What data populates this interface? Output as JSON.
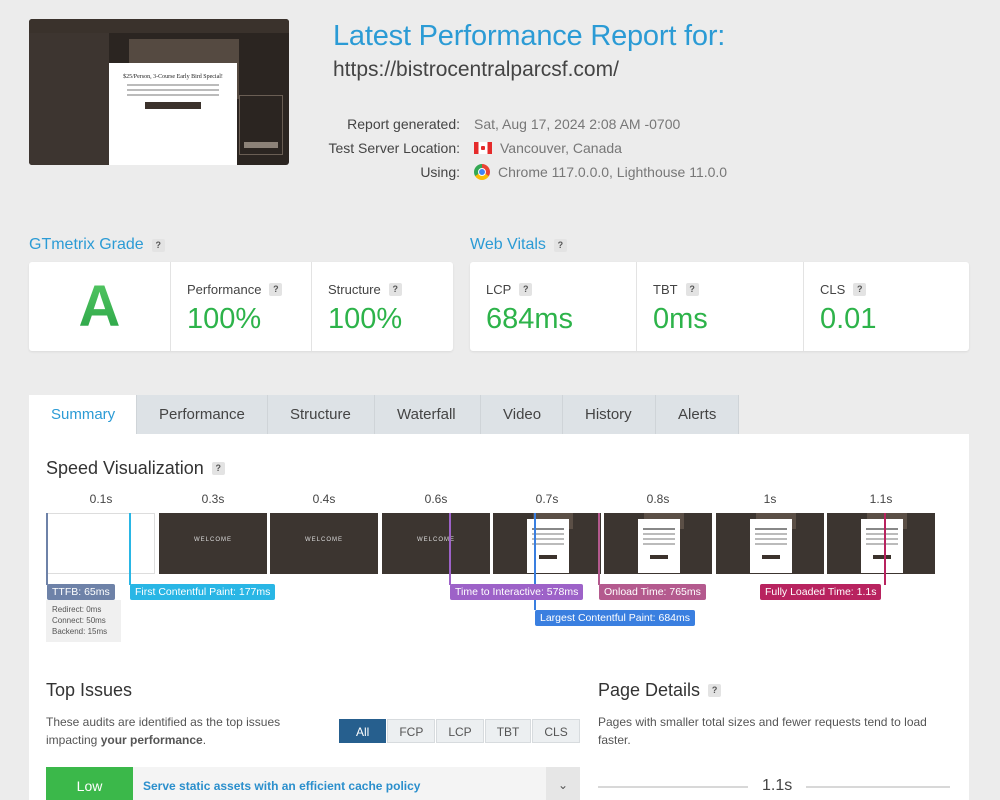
{
  "header": {
    "title": "Latest Performance Report for:",
    "url": "https://bistrocentralparcsf.com/",
    "report_generated_label": "Report generated:",
    "report_generated_value": "Sat, Aug 17, 2024 2:08 AM -0700",
    "server_label": "Test Server Location:",
    "server_value": "Vancouver, Canada",
    "using_label": "Using:",
    "using_value": "Chrome 117.0.0.0, Lighthouse 11.0.0"
  },
  "thumbnail": {
    "modal_text": "$25/Person, 3-Course Early Bird Special!"
  },
  "grade": {
    "title": "GTmetrix Grade",
    "letter": "A",
    "performance_label": "Performance",
    "performance_value": "100%",
    "structure_label": "Structure",
    "structure_value": "100%"
  },
  "vitals": {
    "title": "Web Vitals",
    "lcp_label": "LCP",
    "lcp_value": "684ms",
    "tbt_label": "TBT",
    "tbt_value": "0ms",
    "cls_label": "CLS",
    "cls_value": "0.01"
  },
  "tabs": [
    "Summary",
    "Performance",
    "Structure",
    "Waterfall",
    "Video",
    "History",
    "Alerts"
  ],
  "speed": {
    "title": "Speed Visualization",
    "frame_times": [
      "0.1s",
      "0.3s",
      "0.4s",
      "0.6s",
      "0.7s",
      "0.8s",
      "1s",
      "1.1s"
    ],
    "frame_text": "WELCOME",
    "ttfb": "TTFB: 65ms",
    "ttfb_redirect": "Redirect: 0ms",
    "ttfb_connect": "Connect: 50ms",
    "ttfb_backend": "Backend: 15ms",
    "fcp": "First Contentful Paint: 177ms",
    "tti": "Time to Interactive: 578ms",
    "onload": "Onload Time: 765ms",
    "fully_loaded": "Fully Loaded Time: 1.1s",
    "lcp": "Largest Contentful Paint: 684ms"
  },
  "top_issues": {
    "title": "Top Issues",
    "desc_1": "These audits are identified as the top issues",
    "desc_2": "impacting ",
    "desc_bold": "your performance",
    "desc_end": ".",
    "filters": [
      "All",
      "FCP",
      "LCP",
      "TBT",
      "CLS"
    ],
    "issue_severity": "Low",
    "issue_text": "Serve static assets with an efficient cache policy"
  },
  "page_details": {
    "title": "Page Details",
    "desc": "Pages with smaller total sizes and fewer requests tend to load faster.",
    "fully_loaded": "1.1s"
  },
  "colors": {
    "accent": "#2b9bd5",
    "good": "#2db34a",
    "ttfb": "#6e82a8",
    "fcp": "#29b6e5",
    "tti": "#9d62c8",
    "lcp": "#3a7fe0",
    "onload": "#b45a8e",
    "fully_loaded": "#b8235f"
  }
}
